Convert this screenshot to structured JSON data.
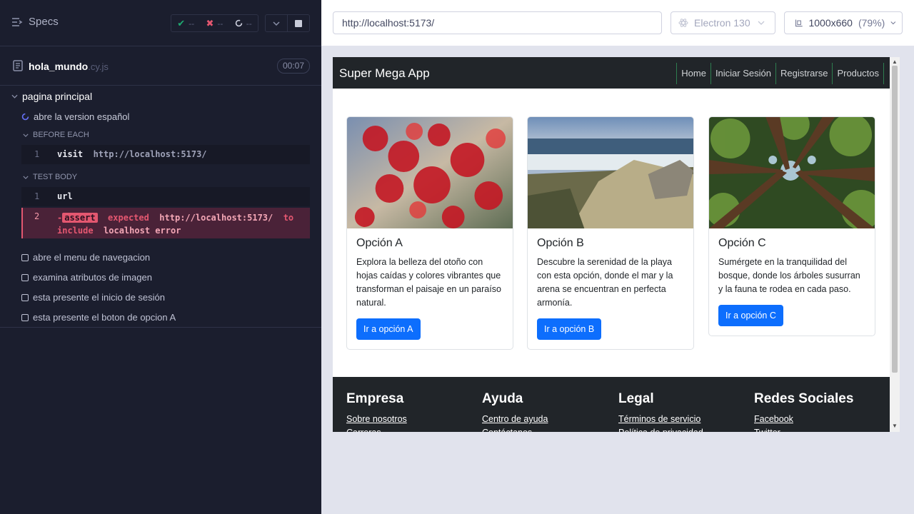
{
  "reporter": {
    "specs_label": "Specs",
    "stats": {
      "passed": "--",
      "failed": "--",
      "pending": "--"
    },
    "spec": {
      "name": "hola_mundo",
      "ext": ".cy.js",
      "duration": "00:07"
    },
    "suite": "pagina principal",
    "running_test": "abre la version español",
    "before_each_label": "BEFORE EACH",
    "test_body_label": "TEST BODY",
    "before_cmds": [
      {
        "num": "1",
        "name": "visit",
        "arg": "http://localhost:5173/"
      }
    ],
    "body_cmds": [
      {
        "num": "1",
        "name": "url"
      },
      {
        "num": "2",
        "prefix": "-",
        "badge": "assert",
        "text1": "expected",
        "url": "http://localhost:5173/",
        "text2": "to",
        "text3": "include",
        "text4": "localhost",
        "text5": "error"
      }
    ],
    "pending_tests": [
      "abre el menu de navegacion",
      "examina atributos de imagen",
      "esta presente el inicio de sesión",
      "esta presente el boton de opcion A"
    ]
  },
  "aut": {
    "url": "http://localhost:5173/",
    "browser": "Electron 130",
    "viewport": "1000x660",
    "zoom": "(79%)"
  },
  "app": {
    "brand": "Super Mega App",
    "nav": [
      "Home",
      "Iniciar Sesión",
      "Registrarse",
      "Productos"
    ],
    "cards": [
      {
        "title": "Opción A",
        "text": "Explora la belleza del otoño con hojas caídas y colores vibrantes que transforman el paisaje en un paraíso natural.",
        "button": "Ir a opción A"
      },
      {
        "title": "Opción B",
        "text": "Descubre la serenidad de la playa con esta opción, donde el mar y la arena se encuentran en perfecta armonía.",
        "button": "Ir a opción B"
      },
      {
        "title": "Opción C",
        "text": "Sumérgete en la tranquilidad del bosque, donde los árboles susurran y la fauna te rodea en cada paso.",
        "button": "Ir a opción C"
      }
    ],
    "footer": [
      {
        "title": "Empresa",
        "links": [
          "Sobre nosotros",
          "Carreras"
        ]
      },
      {
        "title": "Ayuda",
        "links": [
          "Centro de ayuda",
          "Contáctanos"
        ]
      },
      {
        "title": "Legal",
        "links": [
          "Términos de servicio",
          "Política de privacidad"
        ]
      },
      {
        "title": "Redes Sociales",
        "links": [
          "Facebook",
          "Twitter"
        ]
      }
    ]
  },
  "colors": {
    "reporter_bg": "#1b1e2e",
    "fail": "#e45770",
    "primary_btn": "#0d6efd",
    "app_dark": "#212529"
  }
}
